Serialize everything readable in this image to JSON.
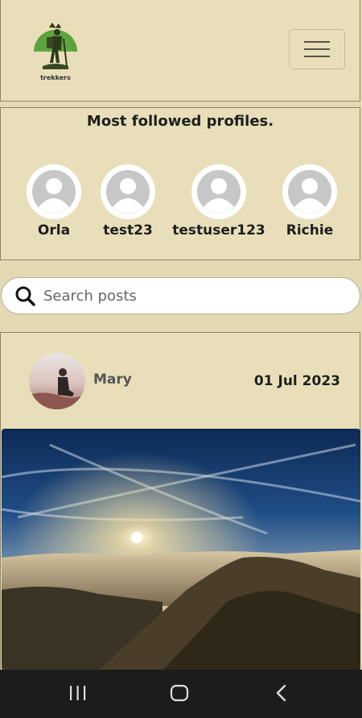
{
  "header": {
    "logo_text": "trekkers",
    "logo_color": "#5da43f",
    "menu_icon": "hamburger-icon"
  },
  "profiles": {
    "title": "Most followed profiles.",
    "items": [
      {
        "name": "Orla"
      },
      {
        "name": "test23"
      },
      {
        "name": "testuser123"
      },
      {
        "name": "Richie"
      }
    ]
  },
  "search": {
    "placeholder": "Search posts",
    "icon": "search-icon"
  },
  "post": {
    "author": "Mary",
    "date": "01 Jul 2023",
    "image": "mountain-sunset-photo"
  },
  "system_nav": {
    "buttons": [
      "recent-apps-icon",
      "home-icon",
      "back-icon"
    ]
  }
}
